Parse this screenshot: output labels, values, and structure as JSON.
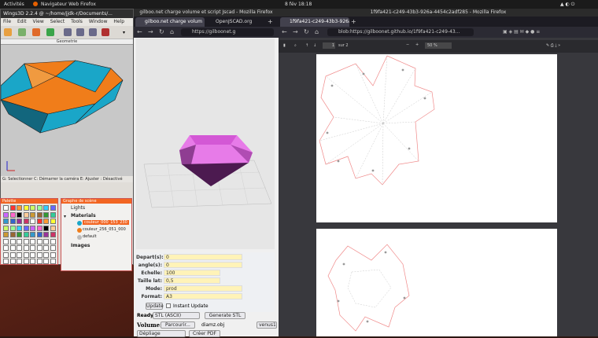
{
  "topbar": {
    "activities": "Activités",
    "app": "Navigateur Web Firefox",
    "clock": "8 fév 18:18"
  },
  "wings": {
    "title": "Wings3D 2.2.4 @ ~/home/jjdk-r/Documents/...",
    "menu": [
      "File",
      "Edit",
      "View",
      "Select",
      "Tools",
      "Window",
      "Help"
    ],
    "viewport_title": "Geometrie",
    "status": "G: Selectionner  C: Démarrer la caméra  E: Ajuster : Désactivé",
    "palette_title": "Palette",
    "outliner_title": "Graphe de scène",
    "outliner": {
      "lights": "Lights",
      "materials": "Materials",
      "mat1": "couleur_000_153_230",
      "mat2": "couleur_256_051_000",
      "mat3": "default",
      "images": "Images"
    }
  },
  "ff_left": {
    "window_title": "gilboo.net charge volume et script Jscad - Mozilla Firefox",
    "tabs": [
      "gilboo.net charge volum",
      "OpenJSCAD.org"
    ],
    "url": "https://gilboonet.g",
    "form": {
      "depart_label": "Depart(s):",
      "depart_value": "0",
      "angle_label": "angle(s):",
      "angle_value": "0",
      "echelle_label": "Echelle:",
      "echelle_value": "100",
      "taille_label": "Taille lat:",
      "taille_value": "0,5",
      "mode_label": "Mode:",
      "mode_value": "prod",
      "format_label": "Format:",
      "format_value": "A3",
      "update_btn": "Update",
      "instant_label": "Instant Update"
    },
    "ready_label": "Ready",
    "format_select": "STL (ASCII)",
    "generate_btn": "Generate STL",
    "volume_label": "Volume:",
    "browse_btn": "Parcourir...",
    "file_name": "diamz.obj",
    "venus_btn": "venus1",
    "depliage_label": "Dépliage",
    "pdf_btn": "Créer PDF"
  },
  "ff_right": {
    "window_title": "1f9fa421-c249-43b3-926a-4454c2adf285 - Mozilla Firefox",
    "tab": "1f9fa421-c249-43b3-926a-4",
    "url": "blob:https://gilboonet.github.io/1f9fa421-c249-43...",
    "page_num": "1",
    "page_of": "sur 2",
    "zoom": "50 %"
  },
  "colors": {
    "orange": "#f07d1a",
    "blue": "#1aa6c8",
    "magenta": "#e77be8",
    "pattern": "#f08a8a"
  }
}
